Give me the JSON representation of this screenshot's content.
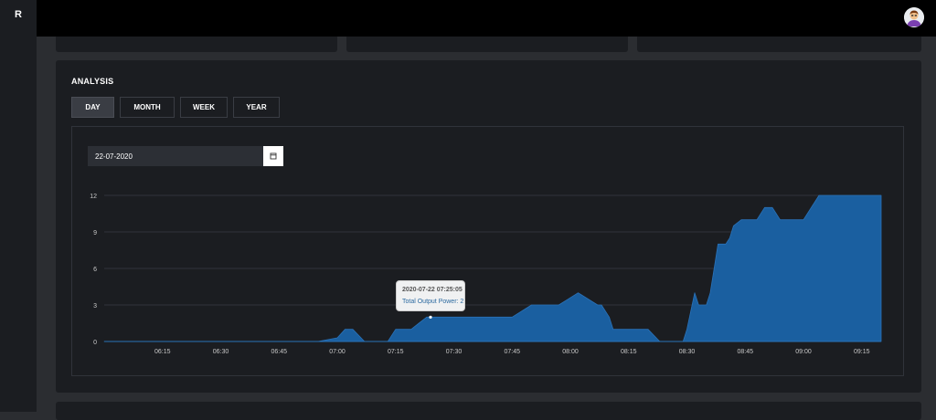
{
  "app": {
    "brand": "R"
  },
  "analysis": {
    "title": "ANALYSIS",
    "tabs": [
      {
        "label": "DAY",
        "active": true
      },
      {
        "label": "MONTH",
        "active": false
      },
      {
        "label": "WEEK",
        "active": false
      },
      {
        "label": "YEAR",
        "active": false
      }
    ],
    "date_value": "22-07-2020"
  },
  "icons": {
    "calendar": "calendar-icon",
    "avatar": "avatar-icon"
  },
  "colors": {
    "series": "#1a5fa0",
    "background": "#1b1d21",
    "grid": "#3a3d44"
  },
  "tooltip": {
    "time": "2020-07-22 07:25:05",
    "text": "Total Output Power: 2"
  },
  "chart_data": {
    "type": "area",
    "ylim": [
      0,
      12
    ],
    "yticks": [
      0,
      3,
      6,
      9,
      12
    ],
    "xticks": [
      "06:15",
      "06:30",
      "06:45",
      "07:00",
      "07:15",
      "07:30",
      "07:45",
      "08:00",
      "08:15",
      "08:30",
      "08:45",
      "09:00",
      "09:15"
    ],
    "xrange": [
      "06:00",
      "09:20"
    ],
    "grid": true,
    "series": [
      {
        "x": [
          "06:00",
          "06:55",
          "07:00",
          "07:02",
          "07:04",
          "07:07",
          "07:10",
          "07:13",
          "07:15",
          "07:19",
          "07:21",
          "07:23",
          "07:25",
          "07:30",
          "07:40",
          "07:43",
          "07:45",
          "07:50",
          "07:53",
          "07:55",
          "07:57",
          "07:59",
          "08:02",
          "08:04",
          "08:07",
          "08:08",
          "08:10",
          "08:11",
          "08:20",
          "08:23",
          "08:26",
          "08:29",
          "08:30",
          "08:32",
          "08:33",
          "08:35",
          "08:36",
          "08:37",
          "08:38",
          "08:40",
          "08:41",
          "08:42",
          "08:44",
          "08:46",
          "08:48",
          "08:50",
          "08:52",
          "08:54",
          "08:56",
          "08:58",
          "09:00",
          "09:04",
          "09:06",
          "09:08",
          "09:20"
        ],
        "y": [
          0,
          0,
          0.3,
          1,
          1,
          0,
          0,
          0,
          1,
          1,
          1.5,
          2,
          2,
          2,
          2,
          2,
          2,
          3,
          3,
          3,
          3,
          3.4,
          4,
          3.6,
          3,
          3,
          2,
          1,
          1,
          0,
          0,
          0,
          1,
          4,
          3,
          3,
          4,
          6,
          8,
          8,
          8.5,
          9.5,
          10,
          10,
          10,
          11,
          11,
          10,
          10,
          10,
          10,
          12,
          12,
          12,
          12
        ]
      }
    ]
  }
}
